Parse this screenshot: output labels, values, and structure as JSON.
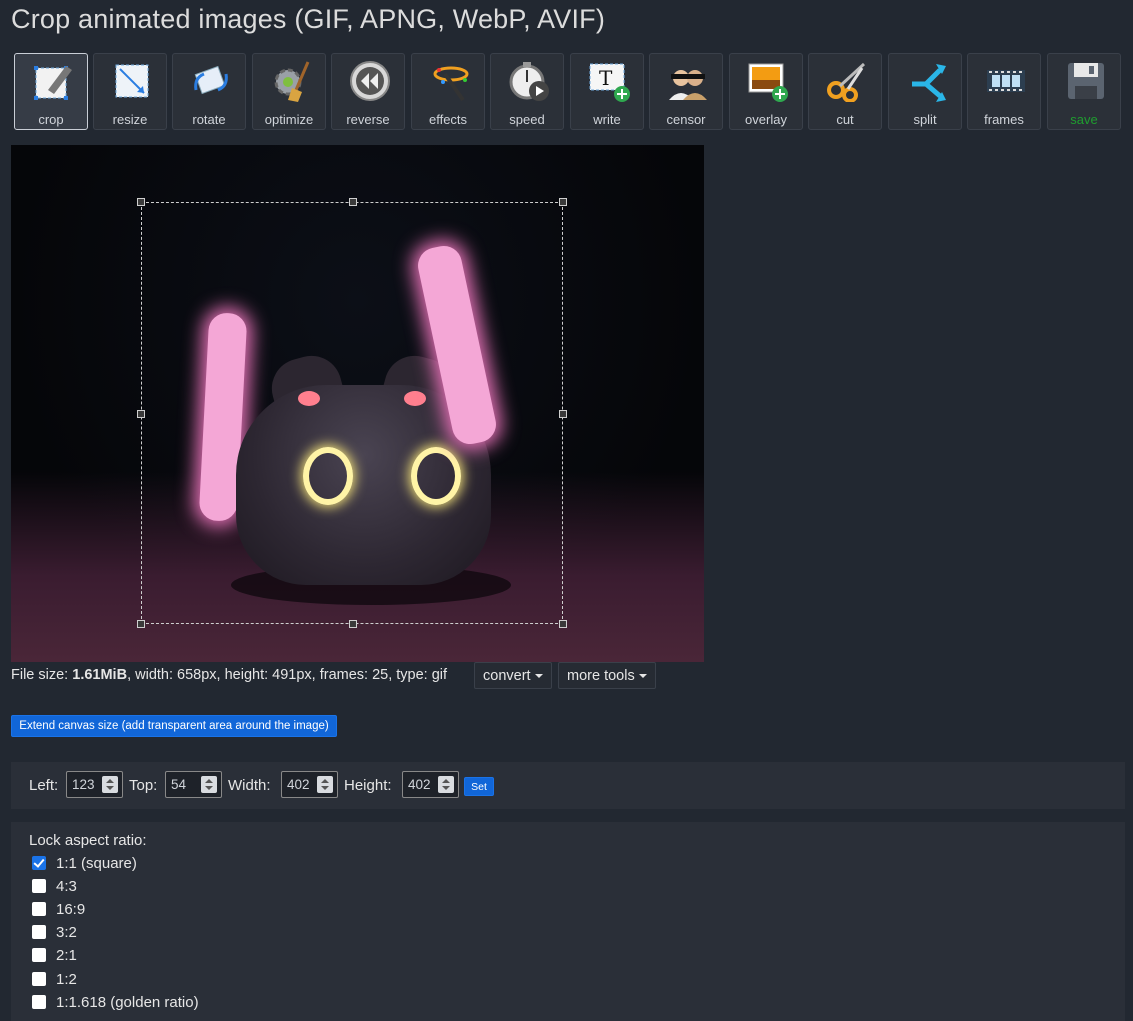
{
  "page": {
    "title": "Crop animated images (GIF, APNG, WebP, AVIF)"
  },
  "toolbar": {
    "tools": [
      {
        "label": "crop",
        "icon": "crop-icon",
        "active": true
      },
      {
        "label": "resize",
        "icon": "resize-icon"
      },
      {
        "label": "rotate",
        "icon": "rotate-icon"
      },
      {
        "label": "optimize",
        "icon": "optimize-icon"
      },
      {
        "label": "reverse",
        "icon": "reverse-icon"
      },
      {
        "label": "effects",
        "icon": "effects-icon"
      },
      {
        "label": "speed",
        "icon": "speed-icon"
      },
      {
        "label": "write",
        "icon": "write-icon"
      },
      {
        "label": "censor",
        "icon": "censor-icon"
      },
      {
        "label": "overlay",
        "icon": "overlay-icon"
      },
      {
        "label": "cut",
        "icon": "cut-icon"
      },
      {
        "label": "split",
        "icon": "split-icon"
      },
      {
        "label": "frames",
        "icon": "frames-icon"
      },
      {
        "label": "save",
        "icon": "save-icon",
        "color": "#1f9d2f"
      }
    ]
  },
  "file_info": {
    "prefix": "File size: ",
    "size": "1.61MiB",
    "details": ", width: 658px, height: 491px, frames: 25, type: gif"
  },
  "menus": {
    "convert": "convert",
    "more_tools": "more tools"
  },
  "extend_button": "Extend canvas size (add transparent area around the image)",
  "crop_fields": {
    "left_label": "Left:",
    "left_value": "123",
    "top_label": "Top:",
    "top_value": "54",
    "width_label": "Width:",
    "width_value": "402",
    "height_label": "Height:",
    "height_value": "402",
    "set_label": "Set"
  },
  "aspect": {
    "title": "Lock aspect ratio:",
    "options": [
      {
        "label": "1:1 (square)",
        "checked": true
      },
      {
        "label": "4:3",
        "checked": false
      },
      {
        "label": "16:9",
        "checked": false
      },
      {
        "label": "3:2",
        "checked": false
      },
      {
        "label": "2:1",
        "checked": false
      },
      {
        "label": "1:2",
        "checked": false
      },
      {
        "label": "1:1.618 (golden ratio)",
        "checked": false
      }
    ]
  },
  "colors": {
    "accent": "#1a73e8",
    "background": "#222831",
    "panel": "#2a2f38",
    "save_green": "#1f9d2f"
  }
}
